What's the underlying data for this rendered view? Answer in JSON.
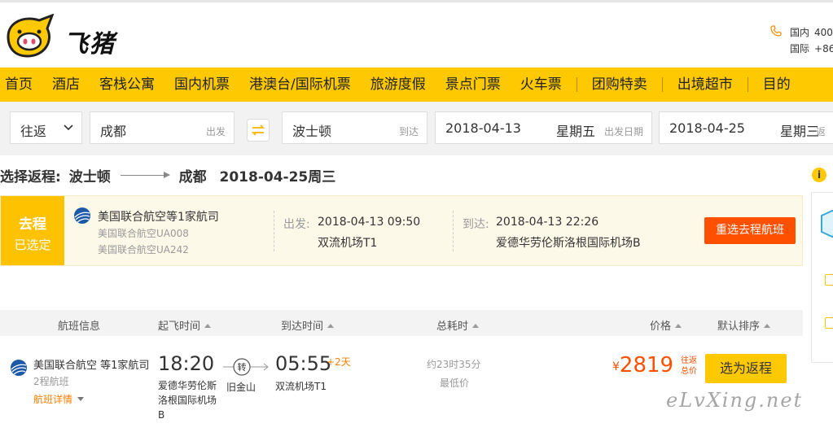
{
  "brand": {
    "name": "飞猪",
    "accent": "#ffc900",
    "orange": "#ff5000"
  },
  "hotline": {
    "domestic_label": "国内",
    "domestic_num": "400",
    "intl_label": "国际",
    "intl_num": "+86"
  },
  "nav": [
    "首页",
    "酒店",
    "客栈公寓",
    "国内机票",
    "港澳台/国际机票",
    "旅游度假",
    "景点门票",
    "火车票",
    "团购特卖",
    "出境超市",
    "目的"
  ],
  "search": {
    "trip_type": "往返",
    "from_city": "成都",
    "from_hint": "出发",
    "to_city": "波士顿",
    "to_hint": "到达",
    "dep_date": "2018-04-13",
    "dep_weekday": "星期五",
    "dep_hint": "出发日期",
    "ret_date": "2018-04-25",
    "ret_weekday": "星期三",
    "ret_hint": "返"
  },
  "return_title": {
    "prefix": "选择返程:",
    "from": "波士顿",
    "to": "成都",
    "date": "2018-04-25周三"
  },
  "outbound": {
    "tag_top": "去程",
    "tag_bottom": "已选定",
    "airline": "美国联合航空等1家航司",
    "flight1": "美国联合航空UA008",
    "flight2": "美国联合航空UA242",
    "dep_label": "出发:",
    "dep_time": "2018-04-13 09:50",
    "dep_airport": "双流机场T1",
    "arr_label": "到达:",
    "arr_time": "2018-04-13 22:26",
    "arr_airport": "爱德华劳伦斯洛根国际机场B",
    "reselect": "重选去程航班"
  },
  "list_header": {
    "info": "航班信息",
    "dep": "起飞时间",
    "arr": "到达时间",
    "dur": "总耗时",
    "price": "价格",
    "sort": "默认排序"
  },
  "flight": {
    "airline": "美国联合航空 等1家航司",
    "hops": "2程航班",
    "detail": "航班详情",
    "dep_time": "18:20",
    "dep_airport": "爱德华劳伦斯洛根国际机场B",
    "transfer_mark": "转",
    "transfer_city": "旧金山",
    "arr_time": "05:55",
    "arr_plus": "+2天",
    "arr_airport": "双流机场T1",
    "duration": "约23时35分",
    "lowest": "最低价",
    "currency": "¥",
    "price": "2819",
    "price_note": "往返总价",
    "choose": "选为返程"
  },
  "watermark": "eLvXing.net"
}
